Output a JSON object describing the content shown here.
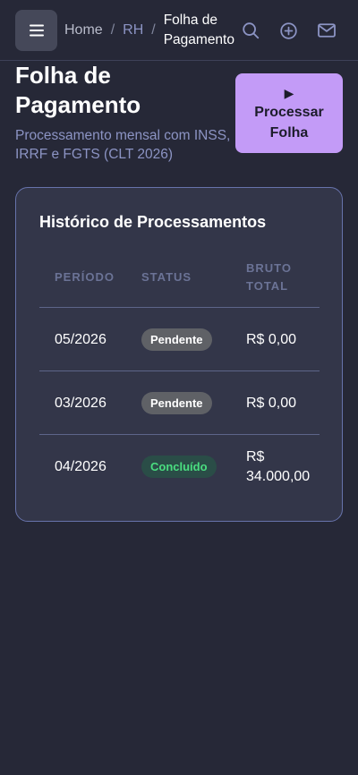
{
  "breadcrumb": {
    "home": "Home",
    "rh": "RH",
    "current": "Folha de Pagamento",
    "separator": "/"
  },
  "header": {
    "title": "Folha de Pagamento",
    "subtitle": "Processamento mensal com INSS, IRRF e FGTS (CLT 2026)",
    "process_button_icon": "▶",
    "process_button_label": "Processar Folha"
  },
  "history": {
    "title": "Histórico de Processamentos",
    "columns": [
      "PERÍODO",
      "STATUS",
      "BRUTO TOTAL"
    ],
    "rows": [
      {
        "period": "05/2026",
        "status": "Pendente",
        "gross": "R$ 0,00"
      },
      {
        "period": "03/2026",
        "status": "Pendente",
        "gross": "R$ 0,00"
      },
      {
        "period": "04/2026",
        "status": "Concluído",
        "gross": "R$ 34.000,00"
      }
    ]
  },
  "icons": {
    "menu": "menu-icon",
    "search": "search-icon",
    "add": "plus-circle-icon",
    "mail": "mail-icon"
  },
  "colors": {
    "background": "#262837",
    "accent": "#c39bf7",
    "card_border": "#6773ab",
    "status_done": "#4ade80",
    "status_pending": "#5f6166"
  }
}
